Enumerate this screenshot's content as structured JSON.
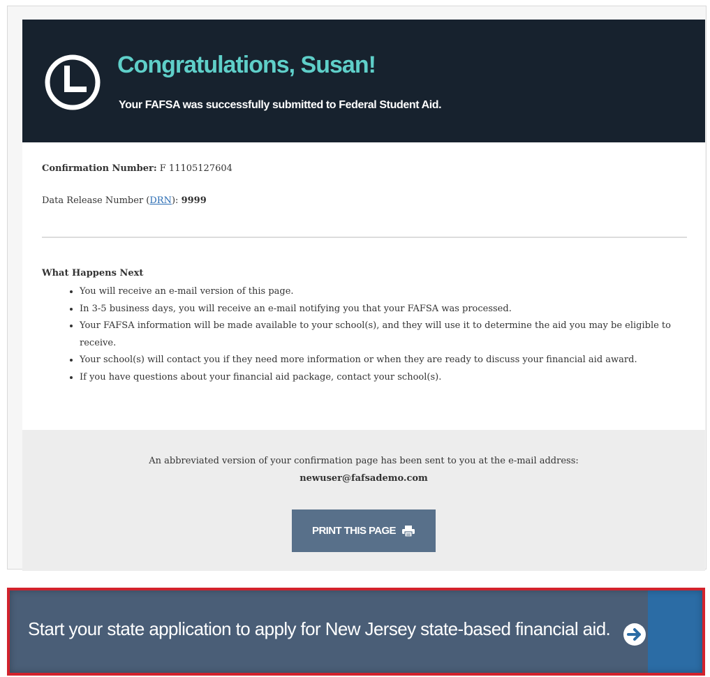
{
  "banner": {
    "title": "Congratulations, Susan!",
    "subtitle": "Your FAFSA was successfully submitted to Federal Student Aid."
  },
  "confirmation": {
    "label": "Confirmation Number:",
    "value": "F 11105127604"
  },
  "drn": {
    "prefix": "Data Release Number (",
    "link_text": "DRN",
    "suffix": "):",
    "value": "9999"
  },
  "next_steps": {
    "heading": "What Happens Next",
    "items": [
      "You will receive an e-mail version of this page.",
      "In 3-5 business days, you will receive an e-mail notifying you that your FAFSA was processed.",
      "Your FAFSA information will be made available to your school(s), and they will use it to determine the aid you may be eligible to receive.",
      "Your school(s) will contact you if they need more information or when they are ready to discuss your financial aid award.",
      "If you have questions about your financial aid package, contact your school(s)."
    ]
  },
  "email_notice": {
    "text": "An abbreviated version of your confirmation page has been sent to you at the e-mail address:",
    "address": "newuser@fafsademo.com"
  },
  "print_button": {
    "label": "PRINT THIS PAGE",
    "icon": "printer-icon"
  },
  "state_cta": {
    "text": "Start your state application to apply for New Jersey state-based financial aid.",
    "icon": "arrow-right-circle-icon"
  },
  "colors": {
    "banner_bg": "#17222e",
    "title_teal": "#5fcfc9",
    "button_slate": "#58708a",
    "cta_bg": "#4a5e77",
    "cta_block_blue": "#2b6ca5",
    "highlight_red": "#d2222c",
    "link_blue": "#2a6cb3"
  }
}
